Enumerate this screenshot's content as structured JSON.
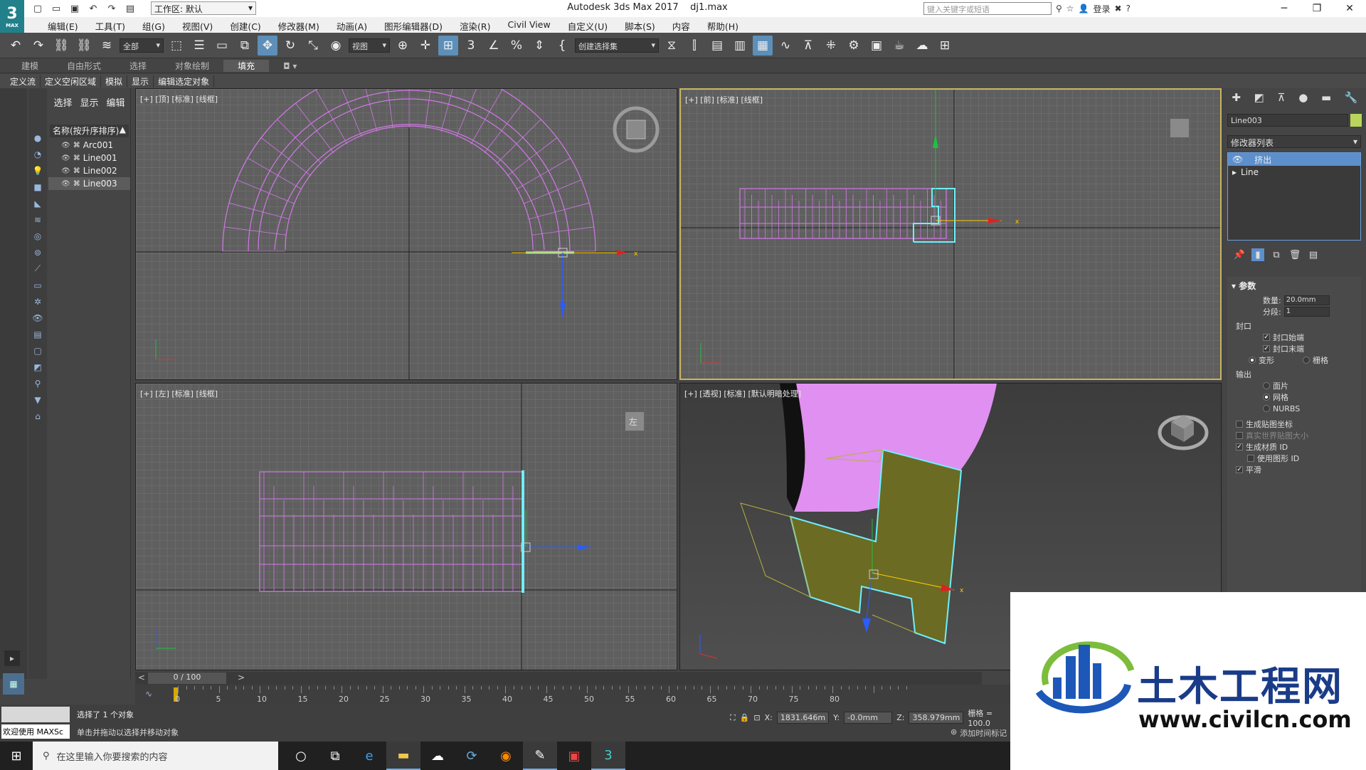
{
  "app": {
    "logo": "3",
    "logo_sub": "MAX",
    "title": "Autodesk 3ds Max 2017",
    "file": "dj1.max",
    "workspace": "工作区: 默认"
  },
  "search": {
    "placeholder": "键入关键字或短语",
    "login": "登录"
  },
  "menu": [
    "编辑(E)",
    "工具(T)",
    "组(G)",
    "视图(V)",
    "创建(C)",
    "修改器(M)",
    "动画(A)",
    "图形编辑器(D)",
    "渲染(R)",
    "Civil View",
    "自定义(U)",
    "脚本(S)",
    "内容",
    "帮助(H)"
  ],
  "toolbar": {
    "filter": "全部",
    "refcoord": "视图",
    "selset": "创建选择集"
  },
  "ribbon": {
    "tabs": [
      "建模",
      "自由形式",
      "选择",
      "对象绘制",
      "填充"
    ],
    "active": "填充",
    "subtabs": [
      "定义流",
      "定义空闲区域",
      "模拟",
      "显示",
      "编辑选定对象"
    ]
  },
  "explorer": {
    "tabs": [
      "选择",
      "显示",
      "编辑"
    ],
    "header": "名称(按升序排序)",
    "items": [
      "Arc001",
      "Line001",
      "Line002",
      "Line003"
    ],
    "selected": "Line003"
  },
  "viewports": {
    "top": "[+] [顶] [标准] [线框]",
    "front": "[+] [前] [标准] [线框]",
    "left": "[+] [左] [标准] [线框]",
    "persp": "[+] [透视] [标准] [默认明暗处理]",
    "cube_left": "左"
  },
  "command": {
    "objname": "Line003",
    "modlist": "修改器列表",
    "stack": [
      "挤出",
      "Line"
    ],
    "rollout": "参数",
    "amount_label": "数量:",
    "amount": "20.0mm",
    "segments_label": "分段:",
    "segments": "1",
    "cap_group": "封口",
    "cap_start": "封口始端",
    "cap_end": "封口末端",
    "morph": "变形",
    "grid": "栅格",
    "output_group": "输出",
    "patch": "面片",
    "mesh": "网格",
    "nurbs": "NURBS",
    "gen_map": "生成贴图坐标",
    "real_world": "真实世界贴图大小",
    "gen_mat": "生成材质 ID",
    "use_shape": "使用图形 ID",
    "smooth": "平滑",
    "colors": {
      "obj": "#b9d65a"
    }
  },
  "timeline": {
    "frame": "0 / 100",
    "ticks": [
      "0",
      "5",
      "10",
      "15",
      "20",
      "25",
      "30",
      "35",
      "40",
      "45",
      "50",
      "55",
      "60",
      "65",
      "70",
      "75",
      "80"
    ]
  },
  "status": {
    "maxscript": "欢迎使用 MAXSc",
    "selected": "选择了 1 个对象",
    "hint": "单击并拖动以选择并移动对象",
    "x_label": "X:",
    "x": "1831.646m",
    "y_label": "Y:",
    "y": "-0.0mm",
    "z_label": "Z:",
    "z": "358.979mm",
    "grid": "栅格 = 100.0",
    "addtime": "添加时间标记"
  },
  "taskbar": {
    "search": "在这里输入你要搜索的内容"
  },
  "watermark": {
    "title": "土木工程网",
    "url": "www.civilcn.com"
  }
}
